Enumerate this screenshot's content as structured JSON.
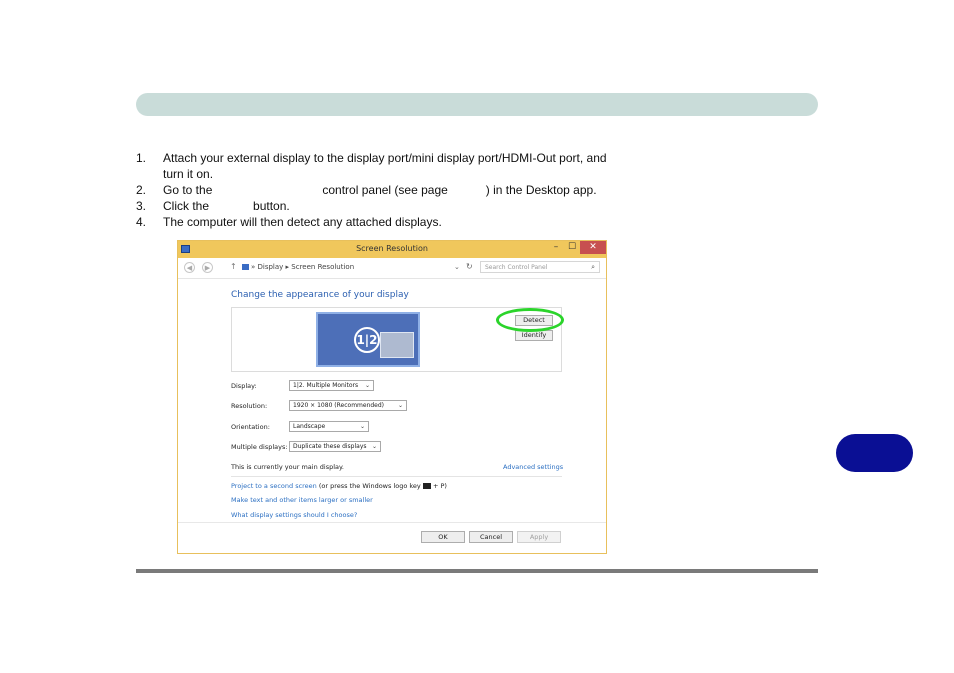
{
  "steps": [
    {
      "num": "1.",
      "line1": "Attach your external display to the display port/mini display port/HDMI-Out port, and",
      "line2": "turn it on."
    },
    {
      "num": "2.",
      "part1": "Go to the",
      "part2": "control panel (see page",
      "part3": ") in the Desktop app."
    },
    {
      "num": "3.",
      "part1": "Click the",
      "part2": "button."
    },
    {
      "num": "4.",
      "text": "The computer will then detect any attached displays."
    }
  ],
  "window": {
    "title": "Screen Resolution",
    "controls": {
      "minimize": "–",
      "maximize": "☐",
      "close": "✕"
    },
    "address": {
      "back": "◀",
      "forward": "▶",
      "up": "↑",
      "crumbs": "» Display ▸ Screen Resolution",
      "dropdown": "⌄",
      "refresh": "↻",
      "search_placeholder": "Search Control Panel",
      "search_icon": "⌕"
    },
    "heading": "Change the appearance of your display",
    "monitor_label": "1|2",
    "detect_label": "Detect",
    "identify_label": "Identify",
    "form": {
      "display_label": "Display:",
      "display_value": "1|2. Multiple Monitors",
      "resolution_label": "Resolution:",
      "resolution_value": "1920 × 1080 (Recommended)",
      "orientation_label": "Orientation:",
      "orientation_value": "Landscape",
      "multiple_label": "Multiple displays:",
      "multiple_value": "Duplicate these displays"
    },
    "main_note": "This is currently your main display.",
    "advanced_link": "Advanced settings",
    "links": {
      "project_link": "Project to a second screen",
      "project_note_a": "(or press the Windows logo key",
      "project_note_b": "+ P)",
      "text_size_link": "Make text and other items larger or smaller",
      "help_link": "What display settings should I choose?"
    },
    "buttons": {
      "ok": "OK",
      "cancel": "Cancel",
      "apply": "Apply"
    }
  },
  "colors": {
    "highlight": "#2bd42b",
    "tab_pill": "#0a0f94",
    "header_bar": "#c9dcd9"
  }
}
